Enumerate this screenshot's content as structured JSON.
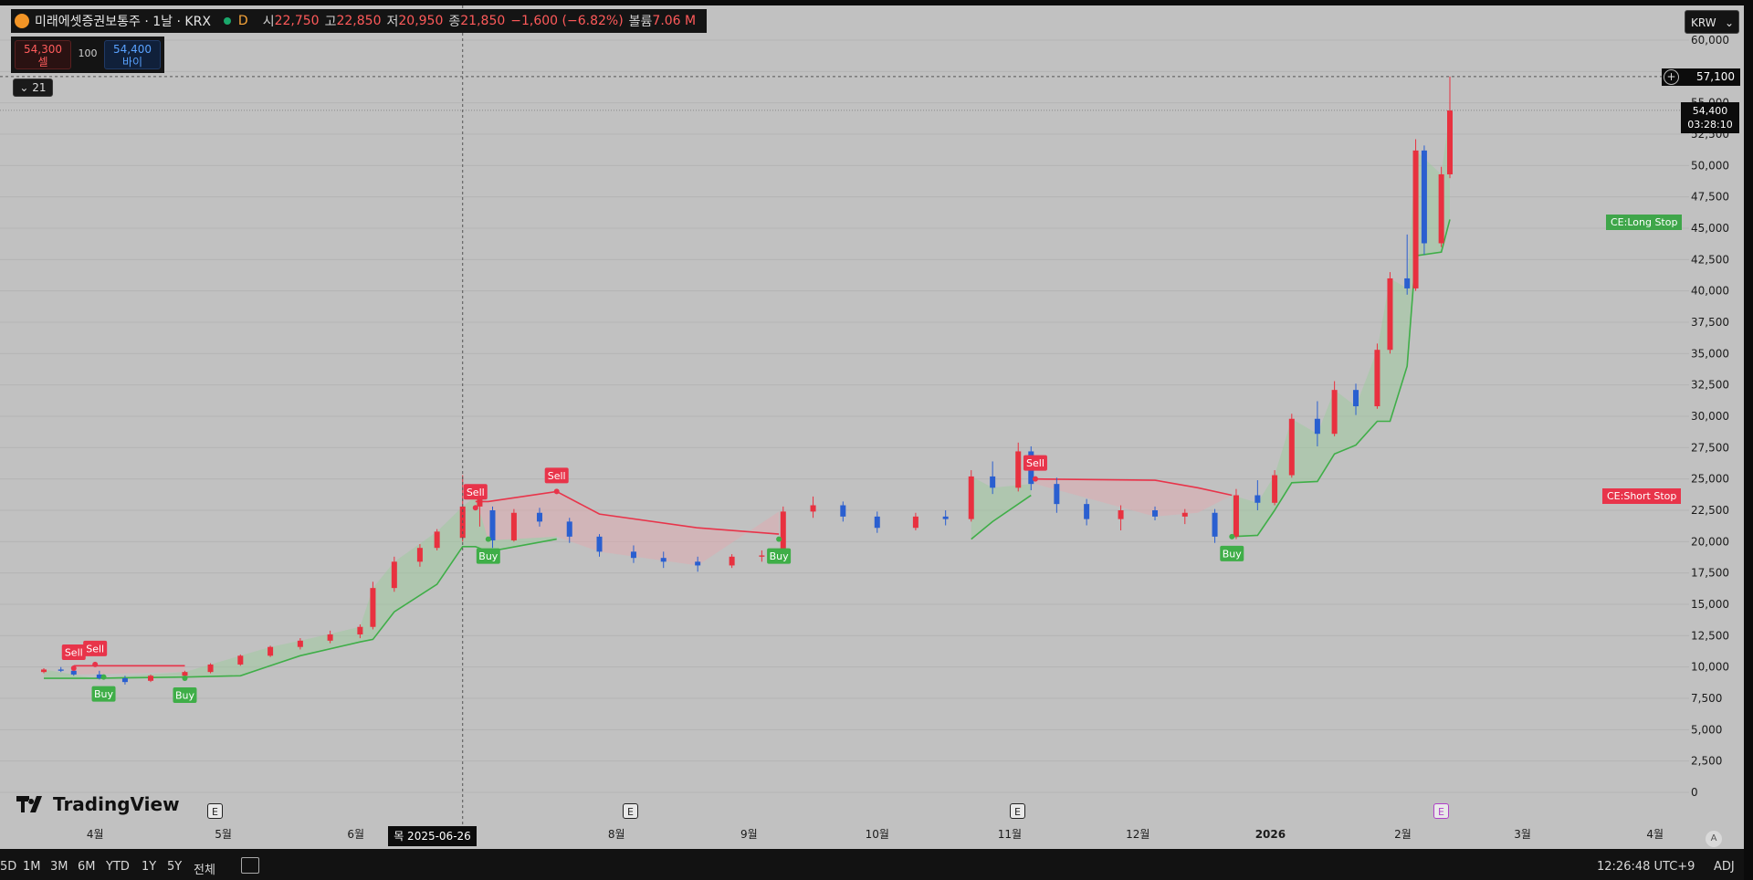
{
  "legend": {
    "symbol": "미래에셋증권보통주 · 1날 · KRX",
    "interval_badge": "D",
    "open_label": "시",
    "open": "22,750",
    "high_label": "고",
    "high": "22,850",
    "low_label": "저",
    "low": "20,950",
    "close_label": "종",
    "close": "21,850",
    "change": "−1,600 (−6.82%)",
    "volume_label": "볼륨",
    "volume": "7.06 M"
  },
  "trade": {
    "sell_price": "54,300",
    "sell_label": "셀",
    "spread": "100",
    "buy_price": "54,400",
    "buy_label": "바이"
  },
  "indicator_toggle": "21",
  "currency": "KRW",
  "last_price": "54,400",
  "countdown": "03:28:10",
  "high_marker": "57,100",
  "crosshair_date": "목 2025-06-26",
  "series_labels": {
    "long_stop": "CE:Long Stop",
    "short_stop": "CE:Short Stop"
  },
  "brand": "TradingView",
  "earnings_mark": "E",
  "auto_scale": "A",
  "bottom": {
    "ranges": [
      "5D",
      "1M",
      "3M",
      "6M",
      "YTD",
      "1Y",
      "5Y",
      "전체"
    ],
    "time": "12:26:48 UTC+9",
    "adj": "ADJ"
  },
  "colors": {
    "up": "#e8313f",
    "down": "#2a5fd0",
    "long_stop": "#3fae48",
    "short_stop": "#e8344a",
    "background": "#c1c1c1"
  },
  "chart_data": {
    "type": "candlestick",
    "ylim": [
      0,
      60000
    ],
    "y_ticks": [
      "0",
      "2,500",
      "5,000",
      "7,500",
      "10,000",
      "12,500",
      "15,000",
      "17,500",
      "20,000",
      "22,500",
      "25,000",
      "27,500",
      "30,000",
      "32,500",
      "35,000",
      "37,500",
      "40,000",
      "42,500",
      "45,000",
      "47,500",
      "50,000",
      "52,500",
      "55,000",
      "60,000"
    ],
    "x_ticks": [
      "4월",
      "5월",
      "6월",
      "8월",
      "9월",
      "10월",
      "11월",
      "12월",
      "2026",
      "2월",
      "3월",
      "4월"
    ],
    "signals": [
      {
        "label": "Sell",
        "date": "2025-03-27",
        "price": 9900
      },
      {
        "label": "Sell",
        "date": "2025-04-01",
        "price": 10200
      },
      {
        "label": "Buy",
        "date": "2025-04-03",
        "price": 9200
      },
      {
        "label": "Buy",
        "date": "2025-04-22",
        "price": 9100
      },
      {
        "label": "Sell",
        "date": "2025-06-29",
        "price": 22700
      },
      {
        "label": "Buy",
        "date": "2025-07-02",
        "price": 20200
      },
      {
        "label": "Sell",
        "date": "2025-07-18",
        "price": 24000
      },
      {
        "label": "Buy",
        "date": "2025-09-08",
        "price": 20200
      },
      {
        "label": "Sell",
        "date": "2025-11-07",
        "price": 25000
      },
      {
        "label": "Buy",
        "date": "2025-12-23",
        "price": 20400
      }
    ],
    "candles": [
      {
        "d": "2025-03-20",
        "o": 9600,
        "h": 9900,
        "l": 9500,
        "c": 9800
      },
      {
        "d": "2025-03-24",
        "o": 9800,
        "h": 10000,
        "l": 9600,
        "c": 9700
      },
      {
        "d": "2025-03-27",
        "o": 9700,
        "h": 10100,
        "l": 9300,
        "c": 9400
      },
      {
        "d": "2025-04-02",
        "o": 9400,
        "h": 9700,
        "l": 9000,
        "c": 9100
      },
      {
        "d": "2025-04-08",
        "o": 9100,
        "h": 9300,
        "l": 8600,
        "c": 8800
      },
      {
        "d": "2025-04-14",
        "o": 8900,
        "h": 9400,
        "l": 8800,
        "c": 9300
      },
      {
        "d": "2025-04-22",
        "o": 9300,
        "h": 9700,
        "l": 9000,
        "c": 9600
      },
      {
        "d": "2025-04-28",
        "o": 9600,
        "h": 10300,
        "l": 9500,
        "c": 10200
      },
      {
        "d": "2025-05-05",
        "o": 10200,
        "h": 11000,
        "l": 10100,
        "c": 10900
      },
      {
        "d": "2025-05-12",
        "o": 10900,
        "h": 11700,
        "l": 10800,
        "c": 11600
      },
      {
        "d": "2025-05-19",
        "o": 11600,
        "h": 12300,
        "l": 11400,
        "c": 12100
      },
      {
        "d": "2025-05-26",
        "o": 12100,
        "h": 12900,
        "l": 11900,
        "c": 12600
      },
      {
        "d": "2025-06-02",
        "o": 12600,
        "h": 13400,
        "l": 12300,
        "c": 13200
      },
      {
        "d": "2025-06-05",
        "o": 13200,
        "h": 16800,
        "l": 13000,
        "c": 16300
      },
      {
        "d": "2025-06-10",
        "o": 16300,
        "h": 18800,
        "l": 16000,
        "c": 18400
      },
      {
        "d": "2025-06-16",
        "o": 18400,
        "h": 19800,
        "l": 18000,
        "c": 19500
      },
      {
        "d": "2025-06-20",
        "o": 19500,
        "h": 21000,
        "l": 19300,
        "c": 20800
      },
      {
        "d": "2025-06-26",
        "o": 20300,
        "h": 25300,
        "l": 20000,
        "c": 22800
      },
      {
        "d": "2025-06-30",
        "o": 22800,
        "h": 24000,
        "l": 21200,
        "c": 23600
      },
      {
        "d": "2025-07-03",
        "o": 22500,
        "h": 22800,
        "l": 19500,
        "c": 20100
      },
      {
        "d": "2025-07-08",
        "o": 20100,
        "h": 22600,
        "l": 20000,
        "c": 22300
      },
      {
        "d": "2025-07-14",
        "o": 22300,
        "h": 22700,
        "l": 21200,
        "c": 21600
      },
      {
        "d": "2025-07-21",
        "o": 21600,
        "h": 21900,
        "l": 19900,
        "c": 20400
      },
      {
        "d": "2025-07-28",
        "o": 20400,
        "h": 20600,
        "l": 18800,
        "c": 19200
      },
      {
        "d": "2025-08-05",
        "o": 19200,
        "h": 19700,
        "l": 18300,
        "c": 18700
      },
      {
        "d": "2025-08-12",
        "o": 18700,
        "h": 19200,
        "l": 17900,
        "c": 18400
      },
      {
        "d": "2025-08-20",
        "o": 18400,
        "h": 18800,
        "l": 17600,
        "c": 18100
      },
      {
        "d": "2025-08-28",
        "o": 18100,
        "h": 19000,
        "l": 17900,
        "c": 18800
      },
      {
        "d": "2025-09-04",
        "o": 18800,
        "h": 19300,
        "l": 18400,
        "c": 18900
      },
      {
        "d": "2025-09-09",
        "o": 19000,
        "h": 22800,
        "l": 18900,
        "c": 22400
      },
      {
        "d": "2025-09-16",
        "o": 22400,
        "h": 23600,
        "l": 21900,
        "c": 22900
      },
      {
        "d": "2025-09-23",
        "o": 22900,
        "h": 23200,
        "l": 21600,
        "c": 22000
      },
      {
        "d": "2025-10-01",
        "o": 22000,
        "h": 22400,
        "l": 20700,
        "c": 21100
      },
      {
        "d": "2025-10-10",
        "o": 21100,
        "h": 22300,
        "l": 20900,
        "c": 22000
      },
      {
        "d": "2025-10-17",
        "o": 22000,
        "h": 22500,
        "l": 21300,
        "c": 21800
      },
      {
        "d": "2025-10-23",
        "o": 21800,
        "h": 25700,
        "l": 21600,
        "c": 25200
      },
      {
        "d": "2025-10-28",
        "o": 25200,
        "h": 26400,
        "l": 23800,
        "c": 24300
      },
      {
        "d": "2025-11-03",
        "o": 24300,
        "h": 27900,
        "l": 24000,
        "c": 27200
      },
      {
        "d": "2025-11-06",
        "o": 27200,
        "h": 27600,
        "l": 24100,
        "c": 24600
      },
      {
        "d": "2025-11-12",
        "o": 24600,
        "h": 25100,
        "l": 22300,
        "c": 23000
      },
      {
        "d": "2025-11-19",
        "o": 23000,
        "h": 23400,
        "l": 21300,
        "c": 21800
      },
      {
        "d": "2025-11-27",
        "o": 21800,
        "h": 22900,
        "l": 20900,
        "c": 22500
      },
      {
        "d": "2025-12-05",
        "o": 22500,
        "h": 22800,
        "l": 21700,
        "c": 22000
      },
      {
        "d": "2025-12-12",
        "o": 22000,
        "h": 22600,
        "l": 21400,
        "c": 22300
      },
      {
        "d": "2025-12-19",
        "o": 22300,
        "h": 22600,
        "l": 19900,
        "c": 20400
      },
      {
        "d": "2025-12-24",
        "o": 20400,
        "h": 24200,
        "l": 20200,
        "c": 23700
      },
      {
        "d": "2025-12-29",
        "o": 23700,
        "h": 24900,
        "l": 22500,
        "c": 23100
      },
      {
        "d": "2026-01-02",
        "o": 23100,
        "h": 25700,
        "l": 22900,
        "c": 25300
      },
      {
        "d": "2026-01-06",
        "o": 25300,
        "h": 30200,
        "l": 25100,
        "c": 29800
      },
      {
        "d": "2026-01-12",
        "o": 29800,
        "h": 31200,
        "l": 27600,
        "c": 28600
      },
      {
        "d": "2026-01-16",
        "o": 28600,
        "h": 32800,
        "l": 28400,
        "c": 32100
      },
      {
        "d": "2026-01-21",
        "o": 32100,
        "h": 32600,
        "l": 30100,
        "c": 30800
      },
      {
        "d": "2026-01-26",
        "o": 30800,
        "h": 35800,
        "l": 30600,
        "c": 35300
      },
      {
        "d": "2026-01-29",
        "o": 35300,
        "h": 41500,
        "l": 35000,
        "c": 41000
      },
      {
        "d": "2026-02-02",
        "o": 41000,
        "h": 44500,
        "l": 39700,
        "c": 40200
      },
      {
        "d": "2026-02-04",
        "o": 40200,
        "h": 52100,
        "l": 40000,
        "c": 51200
      },
      {
        "d": "2026-02-06",
        "o": 51200,
        "h": 51600,
        "l": 42900,
        "c": 43800
      },
      {
        "d": "2026-02-10",
        "o": 43800,
        "h": 49900,
        "l": 43500,
        "c": 49300
      },
      {
        "d": "2026-02-12",
        "o": 49300,
        "h": 57100,
        "l": 49000,
        "c": 54400
      }
    ],
    "long_stop": [
      {
        "d": "2025-03-20",
        "v": 9100
      },
      {
        "d": "2025-04-01",
        "v": 9100
      },
      {
        "d": "2025-04-22",
        "v": 9200
      },
      {
        "d": "2025-05-05",
        "v": 9300
      },
      {
        "d": "2025-05-12",
        "v": 10100
      },
      {
        "d": "2025-05-19",
        "v": 10900
      },
      {
        "d": "2025-06-02",
        "v": 12000
      },
      {
        "d": "2025-06-05",
        "v": 12200
      },
      {
        "d": "2025-06-10",
        "v": 14400
      },
      {
        "d": "2025-06-20",
        "v": 16600
      },
      {
        "d": "2025-06-26",
        "v": 19600
      },
      {
        "d": "2025-06-29",
        "v": 19600
      },
      {
        "d": "2025-07-02",
        "v": 19200
      },
      {
        "d": "2025-07-18",
        "v": 20200
      },
      {
        "d": "2025-09-08",
        "v": 20200
      },
      {
        "d": "2025-10-23",
        "v": 20200
      },
      {
        "d": "2025-10-28",
        "v": 21600
      },
      {
        "d": "2025-11-06",
        "v": 23700
      },
      {
        "d": "2025-12-23",
        "v": 20400
      },
      {
        "d": "2025-12-29",
        "v": 20500
      },
      {
        "d": "2026-01-02",
        "v": 22500
      },
      {
        "d": "2026-01-06",
        "v": 24700
      },
      {
        "d": "2026-01-12",
        "v": 24800
      },
      {
        "d": "2026-01-16",
        "v": 27000
      },
      {
        "d": "2026-01-21",
        "v": 27700
      },
      {
        "d": "2026-01-26",
        "v": 29600
      },
      {
        "d": "2026-01-29",
        "v": 29600
      },
      {
        "d": "2026-02-02",
        "v": 34000
      },
      {
        "d": "2026-02-04",
        "v": 42800
      },
      {
        "d": "2026-02-10",
        "v": 43100
      },
      {
        "d": "2026-02-12",
        "v": 45700
      }
    ],
    "short_stop": [
      {
        "d": "2025-03-27",
        "v": 10100
      },
      {
        "d": "2025-04-22",
        "v": 10100
      },
      {
        "d": "2025-06-29",
        "v": 23200
      },
      {
        "d": "2025-07-02",
        "v": 23200
      },
      {
        "d": "2025-07-18",
        "v": 24000
      },
      {
        "d": "2025-07-28",
        "v": 22200
      },
      {
        "d": "2025-08-20",
        "v": 21100
      },
      {
        "d": "2025-09-08",
        "v": 20600
      },
      {
        "d": "2025-11-07",
        "v": 25000
      },
      {
        "d": "2025-12-05",
        "v": 24900
      },
      {
        "d": "2025-12-15",
        "v": 24300
      },
      {
        "d": "2025-12-23",
        "v": 23700
      }
    ]
  }
}
